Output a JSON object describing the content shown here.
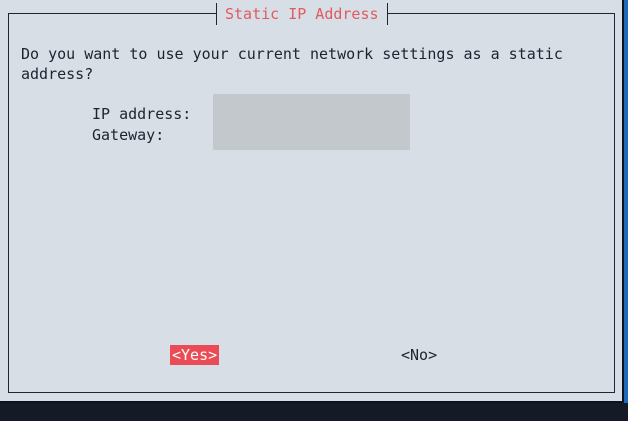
{
  "dialog": {
    "title": "Static IP Address",
    "message": "Do you want to use your current network settings as a static\naddress?",
    "fields": [
      {
        "label": "IP address:"
      },
      {
        "label": "Gateway:"
      }
    ],
    "buttons": {
      "yes": "<Yes>",
      "no": "<No>"
    }
  },
  "colors": {
    "background_blue": "#1e6ab6",
    "dialog_bg": "#d8dee5",
    "title_red": "#e15a62",
    "selected_button_red": "#ea4b55",
    "text_dark": "#1d2330"
  }
}
